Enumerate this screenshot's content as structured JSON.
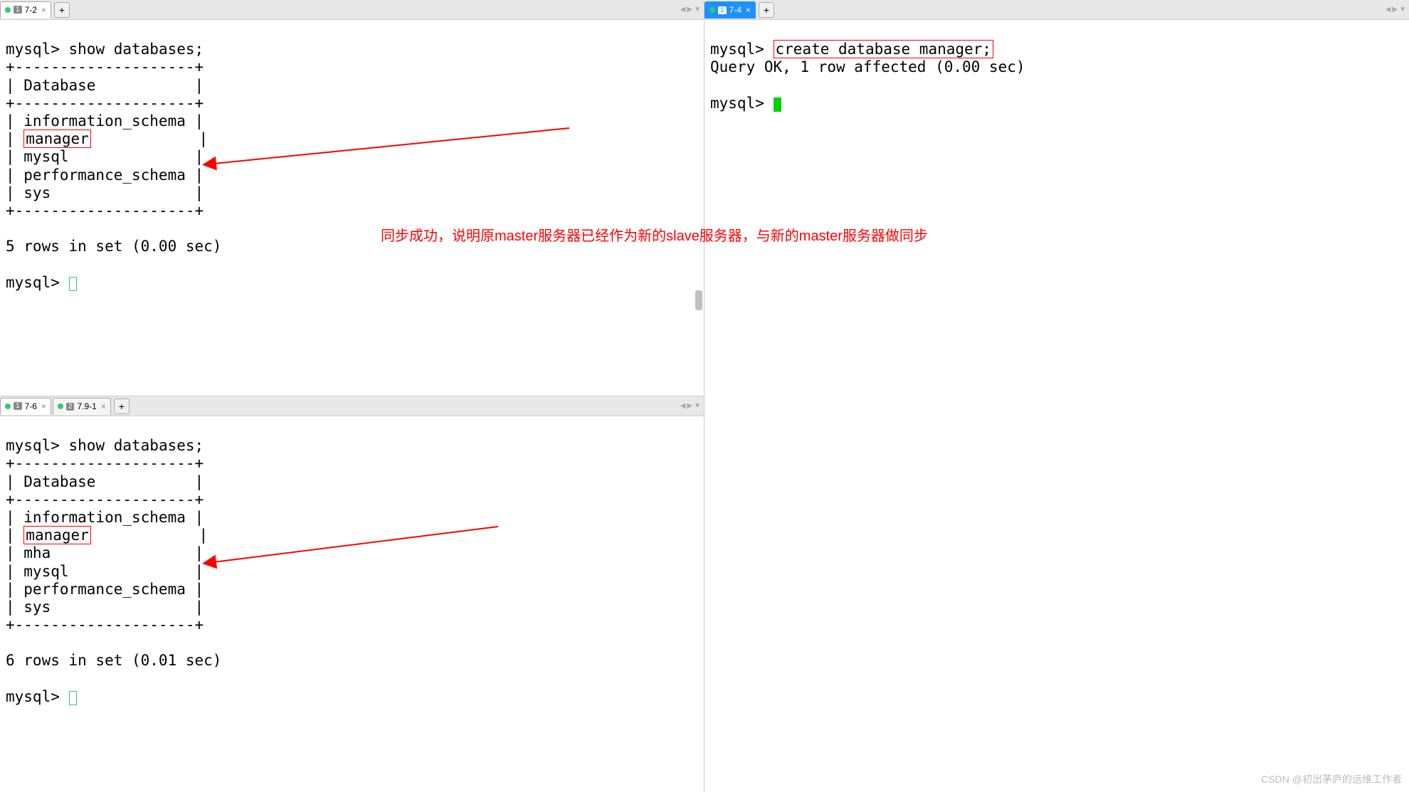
{
  "panes": {
    "topLeft": {
      "tabs": [
        {
          "num": "1",
          "label": "7-2",
          "active": true
        }
      ],
      "terminal": {
        "prompt": "mysql>",
        "command": "show databases;",
        "border": "+--------------------+",
        "header": "| Database           |",
        "rows": [
          "| information_schema |",
          "| manager            |",
          "| mysql              |",
          "| performance_schema |",
          "| sys                |"
        ],
        "highlightRowIndex": 1,
        "highlightText": "manager",
        "footer": "5 rows in set (0.00 sec)",
        "prompt2": "mysql> "
      }
    },
    "bottomLeft": {
      "tabs": [
        {
          "num": "1",
          "label": "7-6",
          "active": true
        },
        {
          "num": "2",
          "label": "7.9-1",
          "active": false
        }
      ],
      "terminal": {
        "prompt": "mysql>",
        "command": "show databases;",
        "border": "+--------------------+",
        "header": "| Database           |",
        "rows": [
          "| information_schema |",
          "| manager            |",
          "| mha                |",
          "| mysql              |",
          "| performance_schema |",
          "| sys                |"
        ],
        "highlightRowIndex": 1,
        "highlightText": "manager",
        "footer": "6 rows in set (0.01 sec)",
        "prompt2": "mysql> "
      }
    },
    "right": {
      "tabs": [
        {
          "num": "1",
          "label": "7-4",
          "active": true
        }
      ],
      "terminal": {
        "prompt": "mysql>",
        "command": "create database manager;",
        "result": "Query OK, 1 row affected (0.00 sec)",
        "prompt2": "mysql> "
      }
    }
  },
  "annotation": "同步成功，说明原master服务器已经作为新的slave服务器，与新的master服务器做同步",
  "watermark": "CSDN @初出茅庐的运维工作者",
  "icons": {
    "close": "×",
    "plus": "+",
    "left": "◀",
    "right": "▶",
    "down": "▼"
  }
}
